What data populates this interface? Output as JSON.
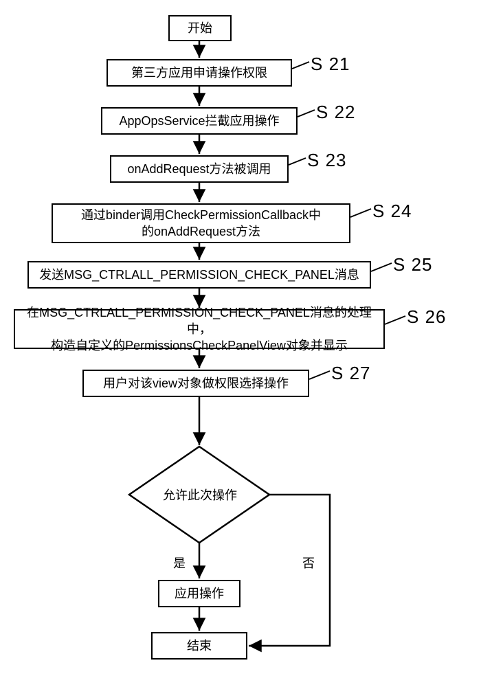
{
  "chart_data": {
    "type": "flowchart",
    "title": "",
    "nodes": [
      {
        "id": "start",
        "shape": "rect",
        "text": "开始"
      },
      {
        "id": "s21",
        "shape": "rect",
        "text": "第三方应用申请操作权限",
        "step": "S 21"
      },
      {
        "id": "s22",
        "shape": "rect",
        "text": "AppOpsService拦截应用操作",
        "step": "S 22"
      },
      {
        "id": "s23",
        "shape": "rect",
        "text": "onAddRequest方法被调用",
        "step": "S 23"
      },
      {
        "id": "s24",
        "shape": "rect",
        "text": "通过binder调用CheckPermissionCallback中\n的onAddRequest方法",
        "step": "S 24"
      },
      {
        "id": "s25",
        "shape": "rect",
        "text": "发送MSG_CTRLALL_PERMISSION_CHECK_PANEL消息",
        "step": "S 25"
      },
      {
        "id": "s26",
        "shape": "rect",
        "text": "在MSG_CTRLALL_PERMISSION_CHECK_PANEL消息的处理中，\n构造自定义的PermissionsCheckPanelView对象并显示",
        "step": "S 26"
      },
      {
        "id": "s27",
        "shape": "rect",
        "text": "用户对该view对象做权限选择操作",
        "step": "S 27"
      },
      {
        "id": "dec",
        "shape": "diamond",
        "text": "允许此次操作"
      },
      {
        "id": "apply",
        "shape": "rect",
        "text": "应用操作"
      },
      {
        "id": "end",
        "shape": "rect",
        "text": "结束"
      }
    ],
    "edges": [
      {
        "from": "start",
        "to": "s21"
      },
      {
        "from": "s21",
        "to": "s22"
      },
      {
        "from": "s22",
        "to": "s23"
      },
      {
        "from": "s23",
        "to": "s24"
      },
      {
        "from": "s24",
        "to": "s25"
      },
      {
        "from": "s25",
        "to": "s26"
      },
      {
        "from": "s26",
        "to": "s27"
      },
      {
        "from": "s27",
        "to": "dec"
      },
      {
        "from": "dec",
        "to": "apply",
        "label": "是"
      },
      {
        "from": "dec",
        "to": "end",
        "label": "否"
      },
      {
        "from": "apply",
        "to": "end"
      }
    ],
    "edge_labels": {
      "yes": "是",
      "no": "否"
    }
  }
}
